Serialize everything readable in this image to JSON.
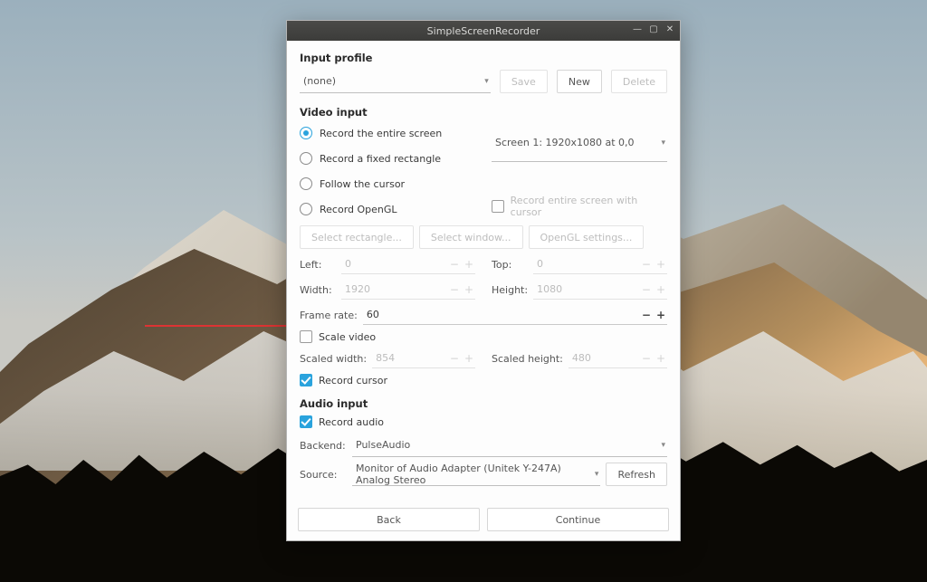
{
  "window": {
    "title": "SimpleScreenRecorder"
  },
  "input_profile": {
    "heading": "Input profile",
    "selected": "(none)",
    "save": "Save",
    "new": "New",
    "delete": "Delete"
  },
  "video_input": {
    "heading": "Video input",
    "mode_entire": "Record the entire screen",
    "mode_rect": "Record a fixed rectangle",
    "mode_cursor": "Follow the cursor",
    "mode_opengl": "Record OpenGL",
    "screen_selected": "Screen 1: 1920x1080 at 0,0",
    "entire_with_cursor": "Record entire screen with cursor",
    "btn_select_rect": "Select rectangle...",
    "btn_select_window": "Select window...",
    "btn_opengl_settings": "OpenGL settings...",
    "left_label": "Left:",
    "left_val": "0",
    "top_label": "Top:",
    "top_val": "0",
    "width_label": "Width:",
    "width_val": "1920",
    "height_label": "Height:",
    "height_val": "1080",
    "framerate_label": "Frame rate:",
    "framerate_val": "60",
    "scale_video": "Scale video",
    "scaled_w_label": "Scaled width:",
    "scaled_w_val": "854",
    "scaled_h_label": "Scaled height:",
    "scaled_h_val": "480",
    "record_cursor": "Record cursor"
  },
  "audio_input": {
    "heading": "Audio input",
    "record_audio": "Record audio",
    "backend_label": "Backend:",
    "backend_val": "PulseAudio",
    "source_label": "Source:",
    "source_val": "Monitor of Audio Adapter (Unitek Y-247A) Analog Stereo",
    "refresh": "Refresh"
  },
  "nav": {
    "back": "Back",
    "continue": "Continue"
  }
}
